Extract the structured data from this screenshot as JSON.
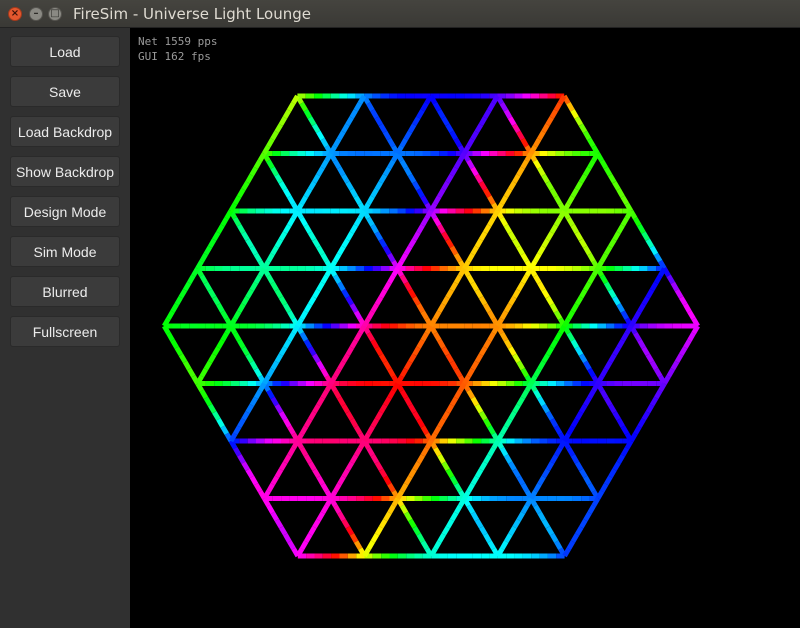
{
  "window": {
    "title": "FireSim - Universe Light Lounge",
    "close_glyph": "×",
    "minimize_glyph": "–",
    "maximize_glyph": "□"
  },
  "sidebar": {
    "buttons": [
      {
        "label": "Load"
      },
      {
        "label": "Save"
      },
      {
        "label": "Load Backdrop"
      },
      {
        "label": "Show Backdrop"
      },
      {
        "label": "Design Mode"
      },
      {
        "label": "Sim Mode"
      },
      {
        "label": "Blurred"
      },
      {
        "label": "Fullscreen"
      }
    ]
  },
  "stats": {
    "net": "Net 1559 pps",
    "gui": "GUI 162 fps"
  },
  "colors": {
    "titlebar": "#3c3b37",
    "sidebar": "#303030",
    "button": "#3b3b3b",
    "canvas": "#000000",
    "close_button": "#e4572e"
  }
}
